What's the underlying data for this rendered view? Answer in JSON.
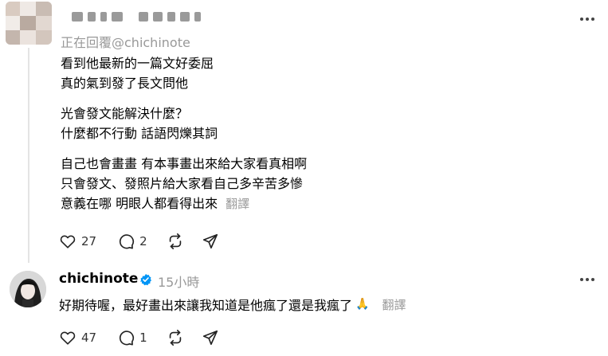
{
  "post1": {
    "reply_to": "正在回覆@chichinote",
    "lines_block1": [
      "看到他最新的一篇文好委屈",
      "真的氣到發了長文問他"
    ],
    "lines_block2": [
      "光會發文能解決什麼？",
      "什麼都不行動 話語閃爍其詞"
    ],
    "lines_block3": [
      "自己也會畫畫 有本事畫出來給大家看真相啊",
      "只會發文、發照片給大家看自己多辛苦多慘"
    ],
    "last_line": "意義在哪 明眼人都看得出來",
    "translate_label": "翻譯",
    "likes": "27",
    "comments": "2",
    "icons": [
      "heart-icon",
      "comment-icon",
      "repost-icon",
      "share-icon",
      "more-icon"
    ]
  },
  "post2": {
    "username": "chichinote",
    "time": "15小時",
    "text": "好期待喔，最好畫出來讓我知道是他瘋了還是我瘋了",
    "emoji": "🙏",
    "translate_label": "翻譯",
    "likes": "47",
    "comments": "1",
    "verified_color": "#0095f6"
  }
}
